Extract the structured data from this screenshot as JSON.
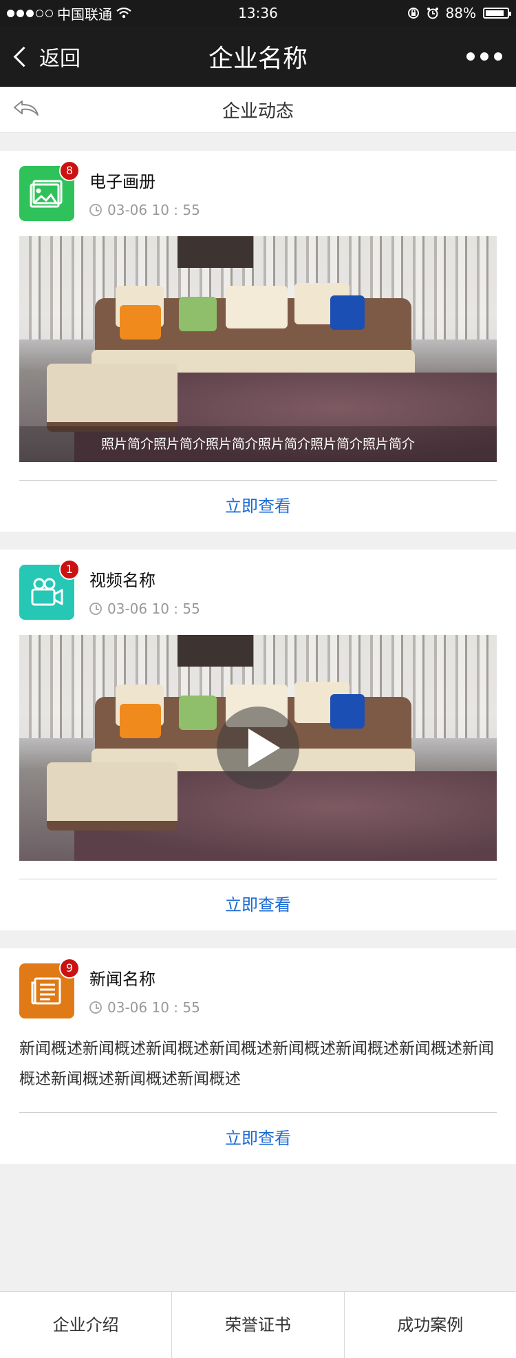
{
  "status_bar": {
    "carrier": "中国联通",
    "time": "13:36",
    "battery_text": "88%",
    "battery_level": 0.88,
    "signal_bars_filled": 3,
    "signal_bars_total": 5,
    "icons": [
      "wifi-icon",
      "rotation-lock-icon",
      "alarm-icon",
      "battery-icon"
    ]
  },
  "nav": {
    "back_label": "返回",
    "title": "企业名称",
    "more_icon": "more-dots-icon"
  },
  "section": {
    "title": "企业动态",
    "reply_icon": "reply-arrow-icon"
  },
  "cards": [
    {
      "type": "album",
      "title": "电子画册",
      "time": "03-06   10 : 55",
      "badge": "8",
      "icon": "picture-icon",
      "icon_color": "#2fc25b",
      "caption": "照片简介照片简介照片简介照片简介照片简介照片简介",
      "view_label": "立即查看"
    },
    {
      "type": "video",
      "title": "视频名称",
      "time": "03-06   10 : 55",
      "badge": "1",
      "icon": "video-camera-icon",
      "icon_color": "#26c7b4",
      "view_label": "立即查看"
    },
    {
      "type": "news",
      "title": "新闻名称",
      "time": "03-06   10 : 55",
      "badge": "9",
      "icon": "newspaper-icon",
      "icon_color": "#e07a16",
      "description": "新闻概述新闻概述新闻概述新闻概述新闻概述新闻概述新闻概述新闻概述新闻概述新闻概述新闻概述",
      "view_label": "立即查看"
    }
  ],
  "bottom_tabs": [
    "企业介绍",
    "荣誉证书",
    "成功案例"
  ],
  "colors": {
    "link_blue": "#1a6ad6",
    "badge_red": "#cc1111",
    "nav_bg": "#1c1c1c"
  }
}
